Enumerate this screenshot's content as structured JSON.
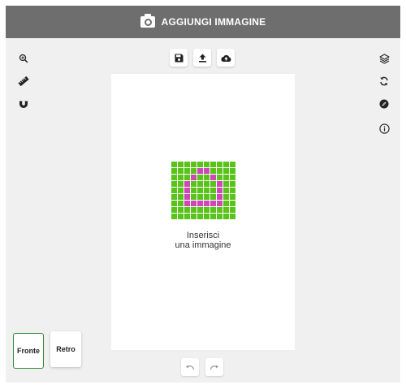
{
  "header": {
    "title": "AGGIUNGI IMMAGINE",
    "icon": "camera-icon"
  },
  "left_toolbar": [
    {
      "name": "zoom",
      "icon": "zoom-in-icon"
    },
    {
      "name": "ruler",
      "icon": "ruler-icon"
    },
    {
      "name": "magnet",
      "icon": "magnet-icon"
    }
  ],
  "top_toolbar": [
    {
      "name": "save",
      "icon": "floppy-disk-icon"
    },
    {
      "name": "upload",
      "icon": "upload-icon"
    },
    {
      "name": "cloud-upload",
      "icon": "cloud-upload-icon"
    }
  ],
  "right_toolbar": [
    {
      "name": "layers",
      "icon": "layers-icon"
    },
    {
      "name": "rotate",
      "icon": "sync-icon"
    },
    {
      "name": "compass",
      "icon": "compass-icon"
    },
    {
      "name": "info",
      "icon": "info-icon"
    }
  ],
  "canvas": {
    "placeholder_line1": "Inserisci",
    "placeholder_line2": "una immagine",
    "placeholder_icon": "image-placeholder-icon",
    "pixel_pattern": [
      "0000000000",
      "0000110000",
      "0001001000",
      "0010000100",
      "0010000100",
      "0010000100",
      "0011111100",
      "0000000000",
      "0000000000"
    ],
    "colors": {
      "pixel_green": "#59c31a",
      "pixel_magenta": "#cc48b5"
    }
  },
  "sides": {
    "front_label": "Fronte",
    "back_label": "Retro",
    "selected": "Fronte"
  },
  "history": [
    {
      "name": "undo",
      "icon": "undo-icon"
    },
    {
      "name": "redo",
      "icon": "redo-icon"
    }
  ],
  "colors": {
    "header_bg": "#6e6e6e",
    "workspace_bg": "#f0f0f0",
    "selected_border": "#2f8a3a"
  }
}
